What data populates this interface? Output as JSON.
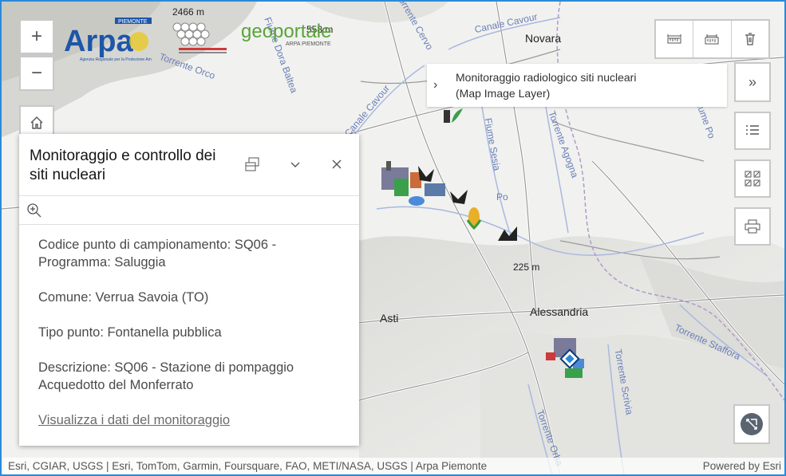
{
  "map": {
    "elevation_1": "2466 m",
    "elevation_2": "558 m",
    "elevation_3": "225 m",
    "cities": [
      "Novara",
      "Asti",
      "Alessandria"
    ],
    "rivers": [
      "Canale Cavour",
      "Torrente Orco",
      "Fiume Dora Baltea",
      "Canale Cavour",
      "Fiume Sesia",
      "Torrente Agogna",
      "Torrente Cervo",
      "Po",
      "Torrente Scrivia",
      "Torrente Orba",
      "Torrente Staffora",
      "Fiume Po"
    ]
  },
  "logos": {
    "arpa": "Arpa",
    "arpa_region": "PIEMONTE",
    "arpa_sub": "Agenzia Regionale per la Protezione Ambientale",
    "geoportale": "geoportale",
    "geoportale_sub": "ARPA PIEMONTE"
  },
  "layer_tooltip": {
    "line1": "Monitoraggio radiologico siti nucleari",
    "line2": "(Map Image Layer)"
  },
  "popup": {
    "title": "Monitoraggio e controllo dei siti nucleari",
    "fields": [
      "Codice punto di campionamento: SQ06 - Programma: Saluggia",
      "Comune: Verrua Savoia (TO)",
      "Tipo punto: Fontanella pubblica",
      "Descrizione: SQ06 - Stazione di pompaggio Acquedotto del Monferrato"
    ],
    "link": "Visualizza i dati del monitoraggio"
  },
  "controls": {
    "zoom_in": "+",
    "zoom_out": "−",
    "layer_expand": "»"
  },
  "attribution": {
    "left": "Esri, CGIAR, USGS | Esri, TomTom, Garmin, Foursquare, FAO, METI/NASA, USGS | Arpa Piemonte",
    "right": "Powered by Esri"
  },
  "colors": {
    "frame": "#2b8ad8",
    "arpa_blue": "#1e56a8",
    "geoportale_green": "#5aa33c"
  }
}
